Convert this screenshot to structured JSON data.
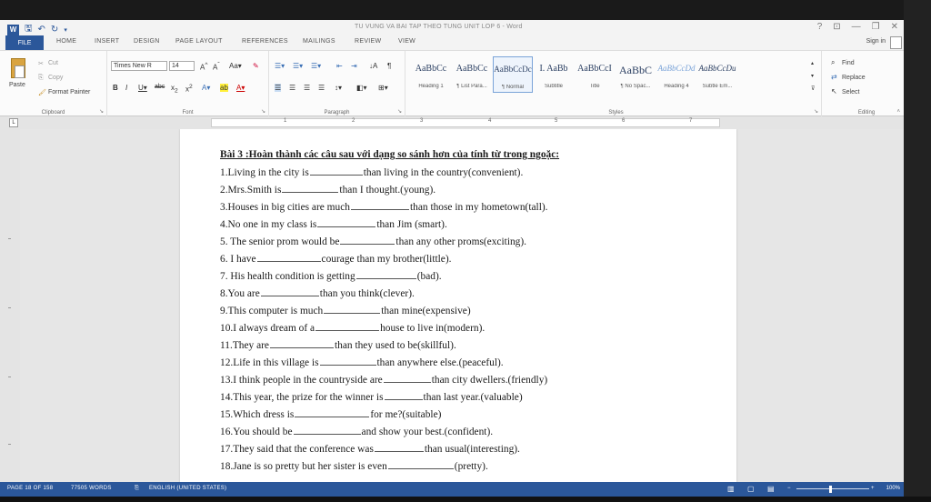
{
  "window": {
    "title": "TU VUNG VA BAI TAP THEO TUNG UNIT LOP 6 - Word",
    "controls": [
      "?",
      "⊡",
      "—",
      "❐",
      "✕"
    ]
  },
  "tabs": {
    "file": "FILE",
    "items": [
      "HOME",
      "INSERT",
      "DESIGN",
      "PAGE LAYOUT",
      "REFERENCES",
      "MAILINGS",
      "REVIEW",
      "VIEW"
    ],
    "sign_in": "Sign in"
  },
  "ribbon": {
    "clipboard": {
      "label": "Clipboard",
      "paste": "Paste",
      "cut": "Cut",
      "copy": "Copy",
      "format_painter": "Format Painter"
    },
    "font": {
      "label": "Font",
      "font_name": "Times New R",
      "font_size": "14"
    },
    "paragraph": {
      "label": "Paragraph"
    },
    "styles": {
      "label": "Styles",
      "items": [
        {
          "preview": "AaBbCc",
          "name": "Heading 1"
        },
        {
          "preview": "AaBbCc",
          "name": "¶ List Para..."
        },
        {
          "preview": "AaBbCcDc",
          "name": "¶ Normal"
        },
        {
          "preview": "I. AaBb",
          "name": "Subtitle"
        },
        {
          "preview": "AaBbCcI",
          "name": "Title"
        },
        {
          "preview": "AaBbC",
          "name": "¶ No Spac..."
        },
        {
          "preview": "AaBbCcDd",
          "name": "Heading 4"
        },
        {
          "preview": "AaBbCcDu",
          "name": "Subtle Em..."
        }
      ]
    },
    "editing": {
      "label": "Editing",
      "find": "Find",
      "replace": "Replace",
      "select": "Select"
    }
  },
  "ruler": {
    "numbers": [
      "1",
      "2",
      "3",
      "4",
      "5",
      "6",
      "7"
    ]
  },
  "document": {
    "heading": "Bài 3 :Hoàn thành các câu sau với dạng so sánh hơn của tính từ trong ngoặc:",
    "questions": [
      {
        "before": "1.Living in the city is",
        "after": "than living in the country(convenient)."
      },
      {
        "before": "2.Mrs.Smith is",
        "after": "than I thought.(young)."
      },
      {
        "before": "3.Houses in big cities are much",
        "after": "than those in my hometown(tall)."
      },
      {
        "before": "4.No one in my class is",
        "after": "than Jim (smart)."
      },
      {
        "before": "5. The senior prom would be",
        "after": "than any other proms(exciting)."
      },
      {
        "before": "6. I have",
        "after": "courage than my brother(little)."
      },
      {
        "before": "7. His health condition is getting",
        "after": "(bad)."
      },
      {
        "before": "8.You are",
        "after": "than you think(clever)."
      },
      {
        "before": "9.This computer is much",
        "after": "than mine(expensive)"
      },
      {
        "before": "10.I always dream of a",
        "after": "house to live in(modern)."
      },
      {
        "before": "11.They are",
        "after": "than they used to be(skillful)."
      },
      {
        "before": "12.Life in this village is",
        "after": "than anywhere else.(peaceful)."
      },
      {
        "before": "13.I think people in the countryside are",
        "after": "than city dwellers.(friendly)"
      },
      {
        "before": "14.This year, the prize for the winner is",
        "after": "than last year.(valuable)"
      },
      {
        "before": "15.Which dress is",
        "after": "for me?(suitable)"
      },
      {
        "before": "16.You should be",
        "after": "and show your best.(confident)."
      },
      {
        "before": "17.They said that the conference was",
        "after": "than usual(interesting)."
      },
      {
        "before": "18.Jane is so pretty but her sister is even",
        "after": "(pretty)."
      }
    ]
  },
  "statusbar": {
    "page": "PAGE 18 OF 158",
    "words": "77505 WORDS",
    "language": "ENGLISH (UNITED STATES)",
    "zoom": "100%"
  },
  "colors": {
    "accent": "#2b579a"
  }
}
